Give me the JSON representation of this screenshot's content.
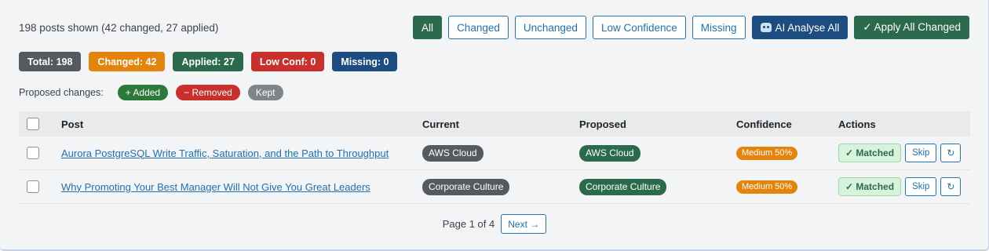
{
  "summary": "198 posts shown (42 changed, 27 applied)",
  "filters": {
    "all": "All",
    "changed": "Changed",
    "unchanged": "Unchanged",
    "low_confidence": "Low Confidence",
    "missing": "Missing",
    "ai_analyse": "AI Analyse All",
    "apply_all": "✓ Apply All Changed"
  },
  "stats": {
    "total": "Total: 198",
    "changed": "Changed: 42",
    "applied": "Applied: 27",
    "low_conf": "Low Conf: 0",
    "missing": "Missing: 0"
  },
  "legend": {
    "label": "Proposed changes:",
    "added": "+ Added",
    "removed": "− Removed",
    "kept": "Kept"
  },
  "table": {
    "headers": {
      "post": "Post",
      "current": "Current",
      "proposed": "Proposed",
      "confidence": "Confidence",
      "actions": "Actions"
    },
    "rows": [
      {
        "post": "Aurora PostgreSQL Write Traffic, Saturation, and the Path to Throughput",
        "current": "AWS Cloud",
        "proposed": "AWS Cloud",
        "confidence": "Medium 50%",
        "status": "✓ Matched",
        "skip": "Skip",
        "redo": "↻"
      },
      {
        "post": "Why Promoting Your Best Manager Will Not Give You Great Leaders",
        "current": "Corporate Culture",
        "proposed": "Corporate Culture",
        "confidence": "Medium 50%",
        "status": "✓ Matched",
        "skip": "Skip",
        "redo": "↻"
      }
    ]
  },
  "pager": {
    "text": "Page 1 of 4",
    "next": "Next →"
  },
  "colors": {
    "green": "#2c6a4d",
    "navy": "#1d4d80",
    "orange": "#e5840b",
    "red": "#c9302c",
    "gray": "#555a60",
    "blue_link": "#2271b1"
  }
}
